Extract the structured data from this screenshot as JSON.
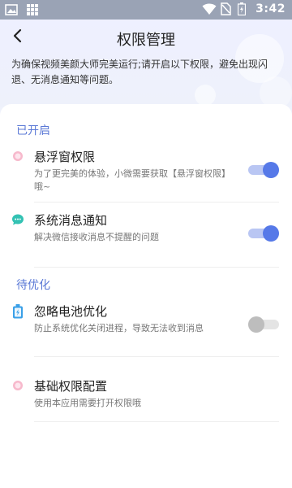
{
  "status_bar": {
    "time": "3:42",
    "left_icons": [
      "image-icon",
      "grid-icon"
    ],
    "right_icons": [
      "wifi-icon",
      "no-sim-icon",
      "battery-icon"
    ]
  },
  "header": {
    "title": "权限管理",
    "intro": "为确保视频美颜大师完美运行;请开启以下权限，避免出现闪退、无消息通知等问题。"
  },
  "sections": [
    {
      "title": "已开启",
      "items": [
        {
          "icon": "pink-dot-icon",
          "title": "悬浮窗权限",
          "desc": "为了更完美的体验，小微需要获取【悬浮窗权限】哦~",
          "toggle": "on"
        },
        {
          "icon": "chat-bubble-icon",
          "title": "系统消息通知",
          "desc": "解决微信接收消息不提醒的问题",
          "toggle": "on"
        }
      ]
    },
    {
      "title": "待优化",
      "items": [
        {
          "icon": "battery-icon",
          "title": "忽略电池优化",
          "desc": "防止系统优化关闭进程，导致无法收到消息",
          "toggle": "off"
        },
        {
          "icon": "pink-dot-icon",
          "title": "基础权限配置",
          "desc": "使用本应用需要打开权限哦",
          "toggle": "none"
        }
      ]
    }
  ],
  "colors": {
    "accent": "#5679e8",
    "section_title": "#5a78d6",
    "status_bar": "#9aa3b5",
    "header_bg": "#eef0ff"
  }
}
